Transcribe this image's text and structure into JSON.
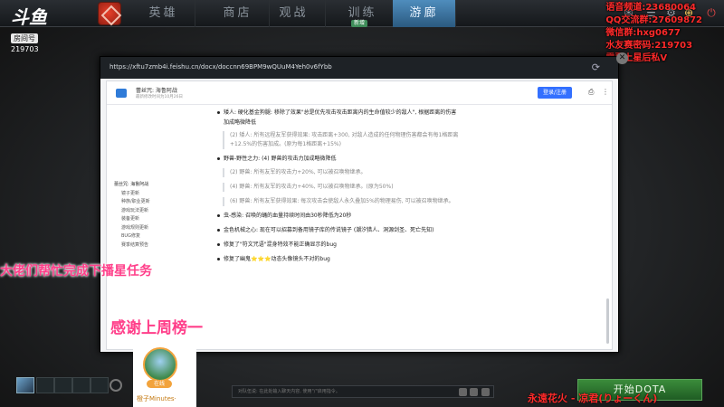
{
  "nav": {
    "tabs": [
      "英雄",
      "商店",
      "观战",
      "训练",
      "游廊"
    ],
    "active_tab": "游廊",
    "badge": "新增"
  },
  "logo": {
    "mark": "斗鱼",
    "room_label": "房间号",
    "room_number": "219703"
  },
  "overlay": {
    "lines": [
      "语音频道:23680064",
      "QQ交流群:27609872",
      "微信群:hxg0677",
      "水友赛密码:219703",
      "需要上星后私V"
    ],
    "banner_left": "大佬们帮忙完成下播星任务",
    "banner_thanks": "感谢上周榜一",
    "signature": "永遠花火 - 凉君(りょーくん)"
  },
  "browser": {
    "url": "https://xftu7zmb4i.feishu.cn/docx/doccnn69BPM9wQUuM4Yeh0v6fYbb",
    "doc_title": "蕾丝咒: 海鲁阿战",
    "doc_subtitle": "最新修改时间为10月26日",
    "login_label": "登录/注册",
    "toc": [
      {
        "label": "蕾丝咒: 海鲁阿战",
        "level": 0
      },
      {
        "label": "镜子更新",
        "level": 1
      },
      {
        "label": "种族/职业更新",
        "level": 1
      },
      {
        "label": "游戏玩法更新",
        "level": 1
      },
      {
        "label": "装备更新",
        "level": 1
      },
      {
        "label": "游戏规则更新",
        "level": 1
      },
      {
        "label": "BUG修复",
        "level": 1
      },
      {
        "label": "赛季结算预告",
        "level": 1
      }
    ],
    "content": [
      {
        "type": "bullet",
        "text": "矮人: 硬化基金狗腿: 移除了效果\"总是优先攻击攻击距离内的生命值较少的敌人\", 根据距离的伤害"
      },
      {
        "type": "plain",
        "text": "加成略微降低"
      },
      {
        "type": "quote",
        "text": "(2) 矮人: 所有远程友军获得效果: 攻击距离+300, 对敌人造成的任何物理伤害都会有每1格距离"
      },
      {
        "type": "quote",
        "text": "+12.5%的伤害加成。(原为每1格距离+15%)"
      },
      {
        "type": "bullet",
        "text": "野兽-野性之力: (4) 野兽的攻击力加成略微降低"
      },
      {
        "type": "quote",
        "text": "(2) 野兽: 所有友军的攻击力+20%, 可以被召唤物继承。"
      },
      {
        "type": "quote",
        "text": "(4) 野兽: 所有友军的攻击力+40%, 可以被召唤物继承。(原为50%)"
      },
      {
        "type": "quote",
        "text": "(6) 野兽: 所有友军获得效果: 每次攻击会使敌人永久叠加5%的物理易伤, 可以被召唤物继承。"
      },
      {
        "type": "bullet",
        "text": "虫-感染: 召唤的蛹的血量持续时间由30秒降低为20秒"
      },
      {
        "type": "bullet",
        "text": "金色机械之心: 现在可以招募到备用镜子库的传说镜子 (潮汐猎人、洞源剑圣、死亡先知)"
      },
      {
        "type": "bullet",
        "text": "修复了\"符文咒语\"混身特效不能正确显示的bug"
      },
      {
        "type": "bullet",
        "text": "修复了幽鬼⭐⭐⭐动态头像镜头不对的bug"
      }
    ]
  },
  "bottom": {
    "avatar_badge": "在线",
    "avatar_name": "橙子Minutes·",
    "chat_placeholder": "对队伍说: 在此处输入聊天内容, 使用\"/\"启用指令。",
    "play_label": "开始DOTA"
  },
  "colors": {
    "active_tab": "#3d7aab",
    "overlay_red": "#ff2a2a",
    "banner_pink": "#ff3f8a",
    "play_green": "#2f7a31",
    "login_blue": "#3370ff"
  }
}
